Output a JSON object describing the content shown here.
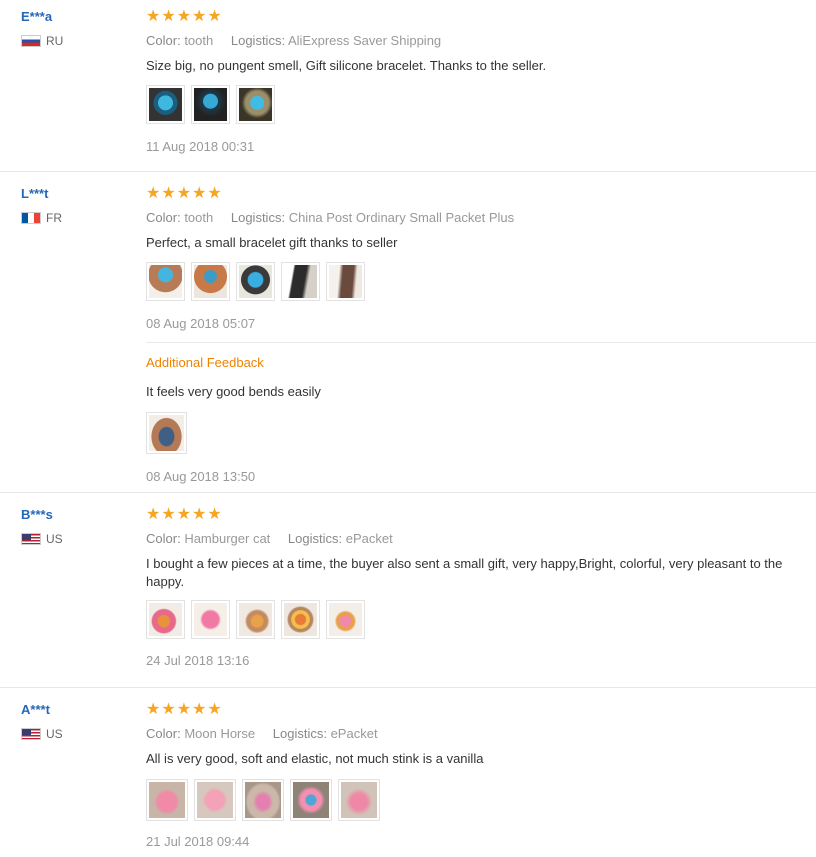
{
  "reviews": [
    {
      "user": "E***a",
      "country": "RU",
      "flag": "ru",
      "color_label": "Color:",
      "color_value": "tooth",
      "logistics_label": "Logistics:",
      "logistics_value": "AliExpress Saver Shipping",
      "text": "Size big, no pungent smell, Gift silicone bracelet. Thanks to the seller.",
      "photo_count": 3,
      "date": "11 Aug 2018 00:31"
    },
    {
      "user": "L***t",
      "country": "FR",
      "flag": "fr",
      "color_label": "Color:",
      "color_value": "tooth",
      "logistics_label": "Logistics:",
      "logistics_value": "China Post Ordinary Small Packet Plus",
      "text": "Perfect, a small bracelet gift thanks to seller",
      "photo_count": 5,
      "date": "08 Aug 2018 05:07",
      "additional": {
        "title": "Additional Feedback",
        "text": "It feels very good bends easily",
        "photo_count": 1,
        "date": "08 Aug 2018 13:50"
      }
    },
    {
      "user": "B***s",
      "country": "US",
      "flag": "us",
      "color_label": "Color:",
      "color_value": "Hamburger cat",
      "logistics_label": "Logistics:",
      "logistics_value": "ePacket",
      "text": "I bought a few pieces at a time, the buyer also sent a small gift, very happy,Bright, colorful, very pleasant to the happy.",
      "photo_count": 5,
      "date": "24 Jul 2018 13:16"
    },
    {
      "user": "A***t",
      "country": "US",
      "flag": "us",
      "color_label": "Color:",
      "color_value": "Moon Horse",
      "logistics_label": "Logistics:",
      "logistics_value": "ePacket",
      "text": "All is very good, soft and elastic, not much stink is a vanilla",
      "photo_count": 5,
      "date": "21 Jul 2018 09:44"
    }
  ],
  "rating_stars": 5,
  "colors": {
    "star": "#f5a623",
    "username": "#2468b8",
    "additional_title": "#f08200"
  }
}
